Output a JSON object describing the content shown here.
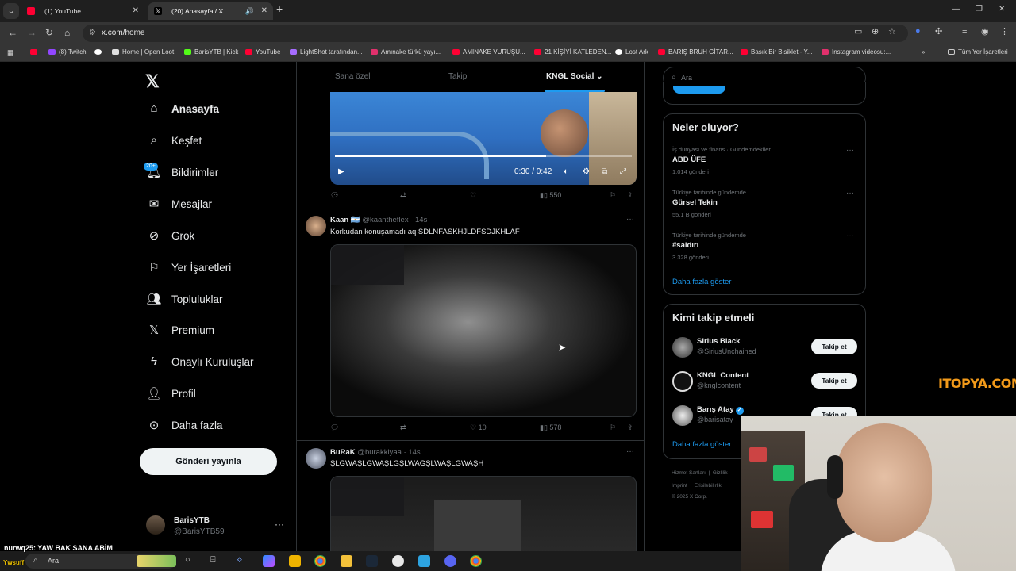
{
  "browser": {
    "tabs": [
      {
        "title": "(1) YouTube",
        "active": false
      },
      {
        "title": "(20) Anasayfa / X",
        "active": true
      }
    ],
    "url": "x.com/home",
    "bookmarks": [
      "(8) Twitch",
      "Home | Open Loot",
      "BarisYTB | Kick",
      "YouTube",
      "LightShot tarafından...",
      "Amınake türkü yayı...",
      "AMINAKE VURUŞU...",
      "21 KİŞİYİ KATLEDEN...",
      "Lost Ark",
      "BARIŞ BRUH GİTAR...",
      "Basık Bir Bisiklet - Y...",
      "Instagram videosu:..."
    ],
    "bookmarks_all": "Tüm Yer İşaretleri"
  },
  "nav": {
    "items": [
      {
        "label": "Anasayfa",
        "icon": "home-icon"
      },
      {
        "label": "Keşfet",
        "icon": "search-icon"
      },
      {
        "label": "Bildirimler",
        "icon": "bell-icon"
      },
      {
        "label": "Mesajlar",
        "icon": "mail-icon"
      },
      {
        "label": "Grok",
        "icon": "grok-icon"
      },
      {
        "label": "Yer İşaretleri",
        "icon": "bookmark-icon"
      },
      {
        "label": "Topluluklar",
        "icon": "communities-icon"
      },
      {
        "label": "Premium",
        "icon": "x-icon"
      },
      {
        "label": "Onaylı Kuruluşlar",
        "icon": "lightning-icon"
      },
      {
        "label": "Profil",
        "icon": "person-icon"
      },
      {
        "label": "Daha fazla",
        "icon": "more-circle-icon"
      }
    ],
    "notifications_badge": "20+",
    "post_button": "Gönderi yayınla",
    "user": {
      "name": "BarisYTB",
      "handle": "@BarisYTB59"
    }
  },
  "feed": {
    "tabs": [
      "Sana özel",
      "Takip",
      "KNGL Social"
    ],
    "video1": {
      "time": "0:30 / 0:42",
      "progress": 0.71,
      "views": "550"
    },
    "tweets": [
      {
        "name": "Kaan 🇦🇷",
        "handle": "@kaantheflex · 14s",
        "text": "Korkudan konuşamadı aq SDLNFASKHJLDFSDJKHLAF",
        "likes": "10",
        "views": "578"
      },
      {
        "name": "BuRaK",
        "handle": "@burakklyaa · 14s",
        "text": "ŞLGWAŞLGWAŞLGŞLWAGŞLWAŞLGWAŞH"
      }
    ]
  },
  "sidebar": {
    "search_placeholder": "Ara",
    "trends_title": "Neler oluyor?",
    "trends": [
      {
        "category": "İş dünyası ve finans · Gündemdekiler",
        "name": "ABD ÜFE",
        "count": "1.014 gönderi"
      },
      {
        "category": "Türkiye tarihinde gündemde",
        "name": "Gürsel Tekin",
        "count": "55,1 B gönderi"
      },
      {
        "category": "Türkiye tarihinde gündemde",
        "name": "#saldırı",
        "count": "3.328 gönderi"
      }
    ],
    "show_more": "Daha fazla göster",
    "who_to_follow_title": "Kimi takip etmeli",
    "who_to_follow": [
      {
        "name": "Sirius Black",
        "handle": "@SiriusUnchained",
        "button": "Takip et"
      },
      {
        "name": "KNGL Content",
        "handle": "@knglcontent",
        "button": "Takip et"
      },
      {
        "name": "Barış Atay",
        "handle": "@barisatay",
        "button": "Takip et"
      }
    ],
    "who_show_more": "Daha fazla göster",
    "footer": [
      "Hizmet Şartları",
      "Gizlilik",
      "Imprint",
      "Erişilebilirlik",
      "© 2025 X Corp."
    ]
  },
  "overlay": {
    "watermark": "ITOPYA.COM",
    "chat": "nurwq25: YAW BAK SANA ABİM",
    "taskbar_user": "Ywsuff",
    "taskbar_search": "Ara"
  }
}
